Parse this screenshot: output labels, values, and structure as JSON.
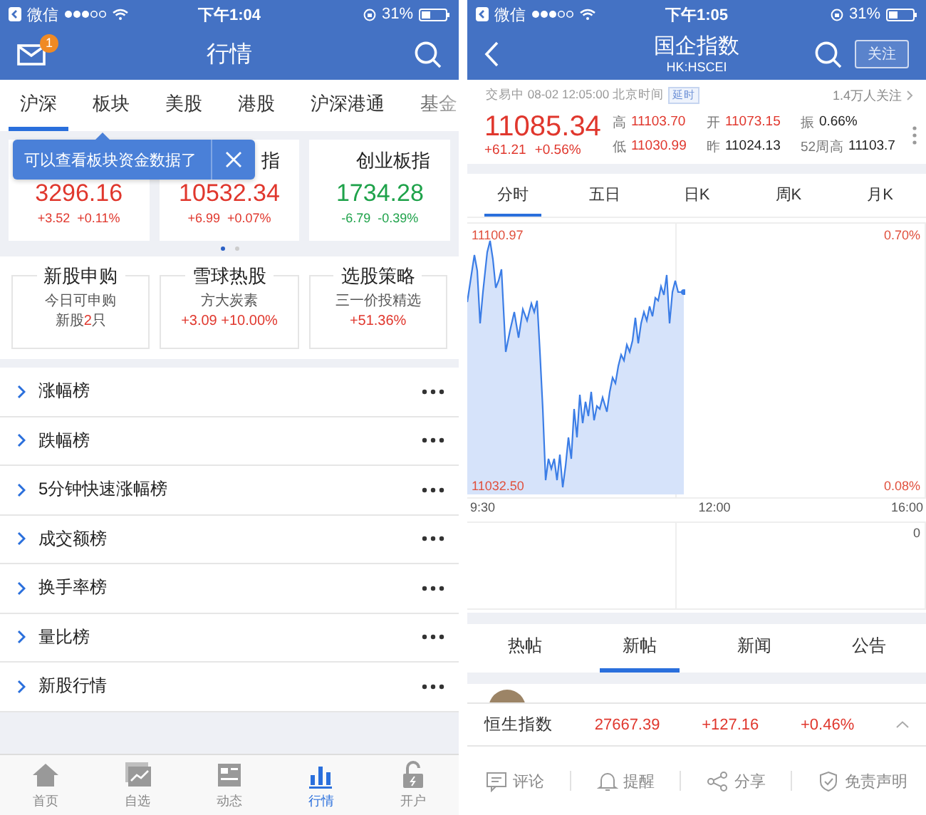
{
  "left": {
    "status_bar": {
      "carrier": "微信",
      "time": "下午1:04",
      "battery": "31%"
    },
    "nav": {
      "title": "行情",
      "badge": "1"
    },
    "tabs": [
      {
        "label": "沪深",
        "selected": true
      },
      {
        "label": "板块",
        "selected": false
      },
      {
        "label": "美股",
        "selected": false
      },
      {
        "label": "港股",
        "selected": false
      },
      {
        "label": "沪深港通",
        "selected": false
      },
      {
        "label": "基金",
        "selected": false
      }
    ],
    "tooltip": "可以查看板块资金数据了",
    "indices": [
      {
        "value": "3296.16",
        "change": "+3.52",
        "percent": "+0.11%",
        "color": "#e0372d"
      },
      {
        "name": "指",
        "value": "10532.34",
        "change": "+6.99",
        "percent": "+0.07%",
        "color": "#e0372d"
      },
      {
        "name": "创业板指",
        "value": "1734.28",
        "change": "-6.79",
        "percent": "-0.39%",
        "color": "#1ea24a"
      }
    ],
    "pager": [
      {
        "selected": true
      },
      {
        "selected": false
      }
    ],
    "features": [
      {
        "title": "新股申购",
        "line1": "今日可申购",
        "line2": "新股**2**只",
        "color": "#555555"
      },
      {
        "title": "雪球热股",
        "line1": "方大炭素",
        "line2": "+3.09 +10.00%",
        "color": "#e0372d"
      },
      {
        "title": "选股策略",
        "line1": "三一价投精选",
        "line2": "+51.36%",
        "color": "#e0372d"
      }
    ],
    "rankings": [
      "涨幅榜",
      "跌幅榜",
      "5分钟快速涨幅榜",
      "成交额榜",
      "换手率榜",
      "量比榜",
      "新股行情"
    ],
    "tab_bar": [
      {
        "label": "首页",
        "selected": false
      },
      {
        "label": "自选",
        "selected": false
      },
      {
        "label": "动态",
        "selected": false
      },
      {
        "label": "行情",
        "selected": true
      },
      {
        "label": "开户",
        "selected": false
      }
    ]
  },
  "right": {
    "status_bar": {
      "carrier": "微信",
      "time": "下午1:05",
      "battery": "31%"
    },
    "nav": {
      "title": "国企指数",
      "subtitle": "HK:HSCEI",
      "follow_button": "关注"
    },
    "info": {
      "status": "交易中 08-02 12:05:00 北京时间",
      "badge": "延时",
      "followers": "1.4万人关注"
    },
    "quote": {
      "price": "11085.34",
      "change": "+61.21",
      "percent": "+0.56%"
    },
    "stats": [
      {
        "label": "高",
        "value": "11103.70",
        "color": "#e0372d"
      },
      {
        "label": "开",
        "value": "11073.15",
        "color": "#e0372d"
      },
      {
        "label": "振",
        "value": "0.66%",
        "color": "#222222"
      },
      {
        "label": "低",
        "value": "11030.99",
        "color": "#e0372d"
      },
      {
        "label": "昨",
        "value": "11024.13",
        "color": "#222222"
      },
      {
        "label": "52周高",
        "value": "11103.7",
        "color": "#222222"
      }
    ],
    "chart_tabs": [
      {
        "label": "分时",
        "selected": true
      },
      {
        "label": "五日",
        "selected": false
      },
      {
        "label": "日K",
        "selected": false
      },
      {
        "label": "周K",
        "selected": false
      },
      {
        "label": "月K",
        "selected": false
      }
    ],
    "chart": {
      "high": "11100.97",
      "high_pct": "0.70%",
      "low": "11032.50",
      "low_pct": "0.08%",
      "times": [
        "9:30",
        "12:00",
        "16:00"
      ],
      "volume_max": "0"
    },
    "post_tabs": [
      {
        "label": "热帖",
        "selected": false
      },
      {
        "label": "新帖",
        "selected": true
      },
      {
        "label": "新闻",
        "selected": false
      },
      {
        "label": "公告",
        "selected": false
      }
    ],
    "ticker": {
      "name": "恒生指数",
      "value": "27667.39",
      "change": "+127.16",
      "percent": "+0.46%"
    },
    "actions": [
      "评论",
      "提醒",
      "分享",
      "免责声明"
    ]
  }
}
